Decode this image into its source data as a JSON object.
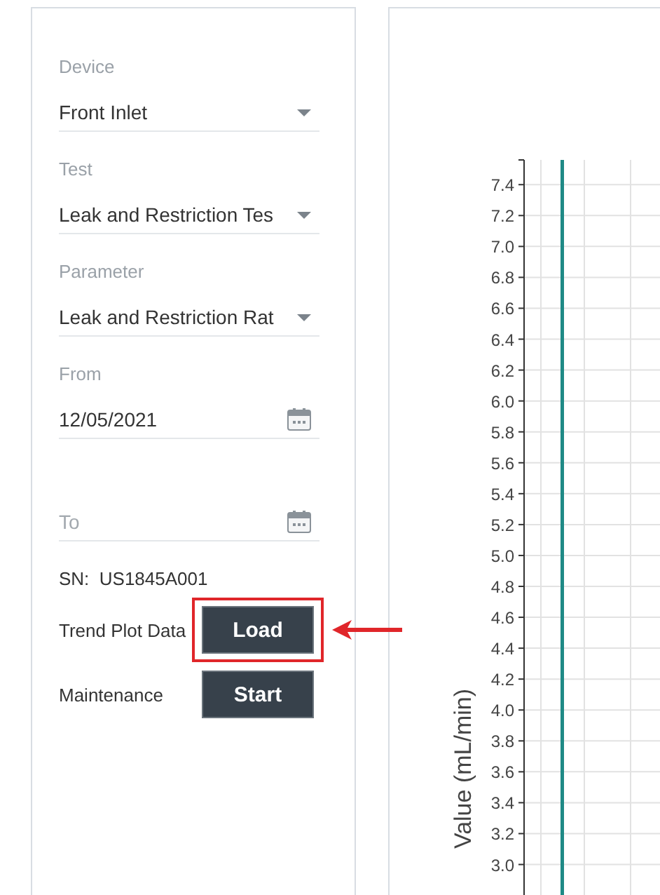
{
  "filters": [
    {
      "kind": "dropdown",
      "label": "Device",
      "value": "Front Inlet"
    },
    {
      "kind": "dropdown",
      "label": "Test",
      "value": "Leak and Restriction Tes"
    },
    {
      "kind": "dropdown",
      "label": "Parameter",
      "value": "Leak and Restriction Rat"
    },
    {
      "kind": "date",
      "label": "From",
      "value": "12/05/2021"
    },
    {
      "kind": "date",
      "placeholder": "To"
    }
  ],
  "serial": {
    "label": "SN:",
    "value": "US1845A001"
  },
  "actions": [
    {
      "label": "Trend Plot Data",
      "button": "Load",
      "highlighted": true
    },
    {
      "label": "Maintenance",
      "button": "Start",
      "highlighted": false
    }
  ],
  "chart": {
    "chart_data": {
      "type": "line",
      "categories": [
        null,
        null,
        null,
        null
      ],
      "ylabel": "Value (mL/min)",
      "ylim": [
        2.73,
        7.56
      ],
      "grid": true,
      "yticks": [
        {
          "value": 3,
          "label": "3.0"
        },
        3.2,
        3.4,
        3.6,
        3.8,
        {
          "value": 4,
          "label": "4.0"
        },
        4.2,
        4.4,
        4.6,
        4.8,
        {
          "value": 5,
          "label": "5.0"
        },
        5.2,
        5.4,
        5.6,
        5.8,
        {
          "value": 6,
          "label": "6.0"
        },
        6.2,
        6.4,
        6.6,
        6.8,
        {
          "value": 7,
          "label": "7.0"
        },
        7.2,
        7.4
      ]
    }
  }
}
